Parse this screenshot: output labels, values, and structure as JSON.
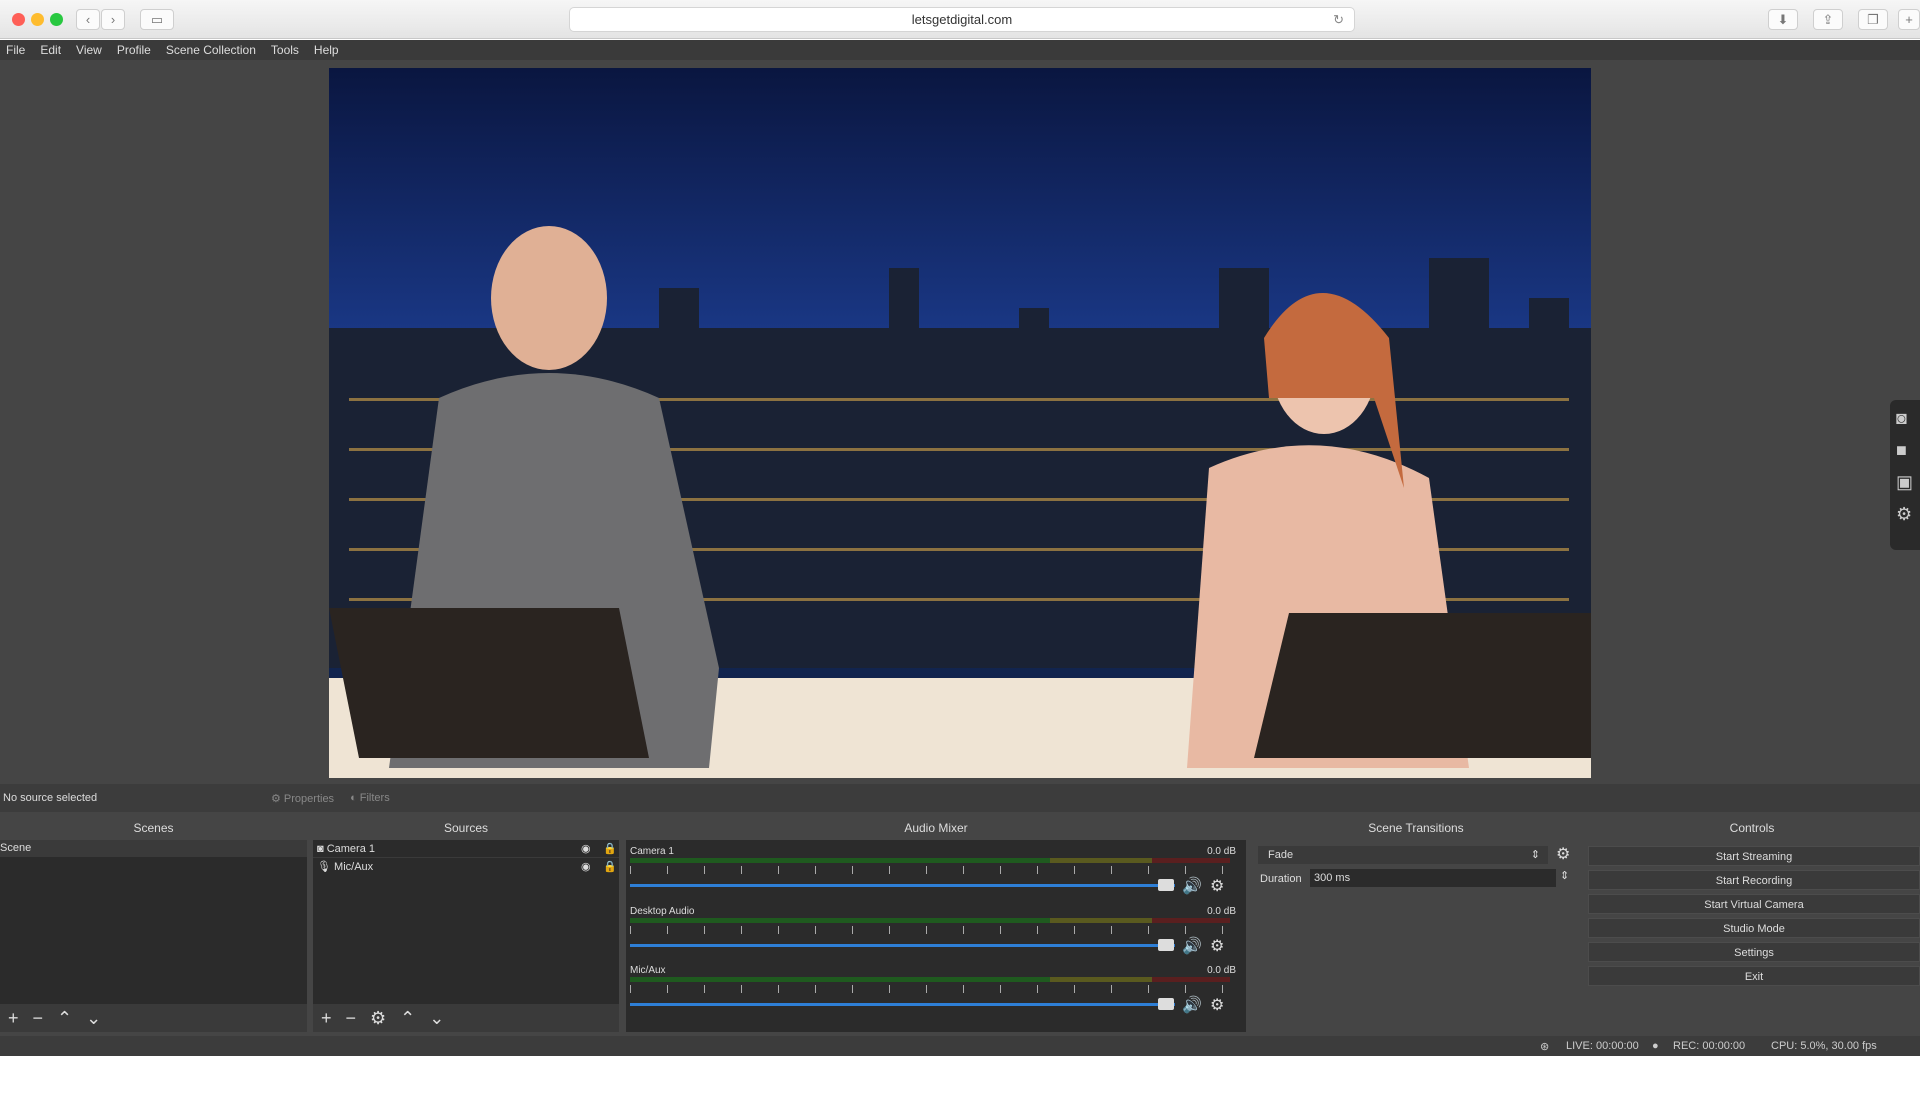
{
  "browser": {
    "url": "letsgetdigital.com"
  },
  "menu": [
    "File",
    "Edit",
    "View",
    "Profile",
    "Scene Collection",
    "Tools",
    "Help"
  ],
  "context": {
    "status": "No source selected",
    "properties": "Properties",
    "filters": "Filters"
  },
  "docks": {
    "scenes": "Scenes",
    "sources": "Sources",
    "mixer": "Audio Mixer",
    "transitions": "Scene Transitions",
    "controls": "Controls"
  },
  "scenes": [
    "Scene"
  ],
  "sources": [
    {
      "name": "Camera 1",
      "icon": "camera-icon"
    },
    {
      "name": "Mic/Aux",
      "icon": "mic-icon"
    }
  ],
  "mixer": [
    {
      "name": "Camera 1",
      "db": "0.0 dB"
    },
    {
      "name": "Desktop Audio",
      "db": "0.0 dB"
    },
    {
      "name": "Mic/Aux",
      "db": "0.0 dB"
    }
  ],
  "meter_ticks": [
    "-60",
    "-55",
    "-50",
    "-45",
    "-40",
    "-35",
    "-30",
    "-25",
    "-20",
    "-15",
    "-10",
    "-5",
    "0"
  ],
  "transitions": {
    "selected": "Fade",
    "duration_label": "Duration",
    "duration": "300 ms"
  },
  "controls": [
    "Start Streaming",
    "Start Recording",
    "Start Virtual Camera",
    "Studio Mode",
    "Settings",
    "Exit"
  ],
  "status": {
    "live": "LIVE: 00:00:00",
    "rec": "REC: 00:00:00",
    "cpu": "CPU: 5.0%, 30.00 fps"
  }
}
